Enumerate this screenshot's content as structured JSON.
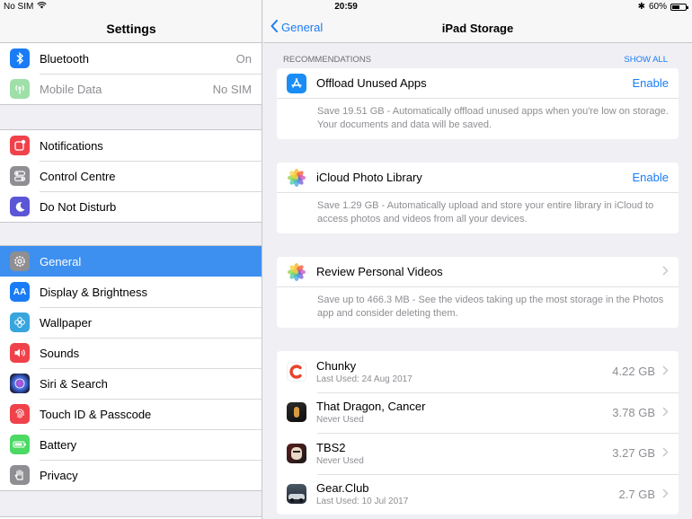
{
  "status": {
    "carrier": "No SIM",
    "time": "20:59",
    "battery": "60%",
    "battery_level": 0.6
  },
  "sidebar": {
    "title": "Settings",
    "group1": [
      {
        "label": "Bluetooth",
        "value": "On",
        "icon": "bluetooth-icon",
        "color": "#1a7cf5"
      },
      {
        "label": "Mobile Data",
        "value": "No SIM",
        "icon": "antenna-icon",
        "color": "#9ee0a8"
      }
    ],
    "group2": [
      {
        "label": "Notifications",
        "icon": "notifications-icon",
        "color": "#f0424a"
      },
      {
        "label": "Control Centre",
        "icon": "switches-icon",
        "color": "#8e8e93"
      },
      {
        "label": "Do Not Disturb",
        "icon": "moon-icon",
        "color": "#5b56d6"
      }
    ],
    "group3": [
      {
        "label": "General",
        "icon": "gear-icon",
        "color": "#8e8e93",
        "selected": true
      },
      {
        "label": "Display & Brightness",
        "icon": "text-size-icon",
        "color": "#1a7cf5"
      },
      {
        "label": "Wallpaper",
        "icon": "flower-icon",
        "color": "#38a5dd"
      },
      {
        "label": "Sounds",
        "icon": "speaker-icon",
        "color": "#f0424a"
      },
      {
        "label": "Siri & Search",
        "icon": "siri-icon",
        "color": "#2c2c6e"
      },
      {
        "label": "Touch ID & Passcode",
        "icon": "fingerprint-icon",
        "color": "#f0424a"
      },
      {
        "label": "Battery",
        "icon": "battery-icon",
        "color": "#4cd964"
      },
      {
        "label": "Privacy",
        "icon": "hand-icon",
        "color": "#8e8e93"
      }
    ]
  },
  "nav": {
    "back": "General",
    "title": "iPad Storage"
  },
  "recommendations": {
    "header": "RECOMMENDATIONS",
    "show_all": "SHOW ALL",
    "items": [
      {
        "title": "Offload Unused Apps",
        "action": "Enable",
        "desc": "Save 19.51 GB - Automatically offload unused apps when you're low on storage. Your documents and data will be saved.",
        "icon": "app-store-icon"
      },
      {
        "title": "iCloud Photo Library",
        "action": "Enable",
        "desc": "Save 1.29 GB - Automatically upload and store your entire library in iCloud to access photos and videos from all your devices.",
        "icon": "photos-icon"
      },
      {
        "title": "Review Personal Videos",
        "action": "",
        "desc": "Save up to 466.3 MB - See the videos taking up the most storage in the Photos app and consider deleting them.",
        "icon": "photos-icon"
      }
    ]
  },
  "apps": [
    {
      "name": "Chunky",
      "sub": "Last Used: 24 Aug 2017",
      "size": "4.22 GB",
      "icon": "chunky-app-icon"
    },
    {
      "name": "That Dragon, Cancer",
      "sub": "Never Used",
      "size": "3.78 GB",
      "icon": "that-dragon-cancer-app-icon"
    },
    {
      "name": "TBS2",
      "sub": "Never Used",
      "size": "3.27 GB",
      "icon": "tbs2-app-icon"
    },
    {
      "name": "Gear.Club",
      "sub": "Last Used: 10 Jul 2017",
      "size": "2.7 GB",
      "icon": "gear-club-app-icon"
    }
  ]
}
